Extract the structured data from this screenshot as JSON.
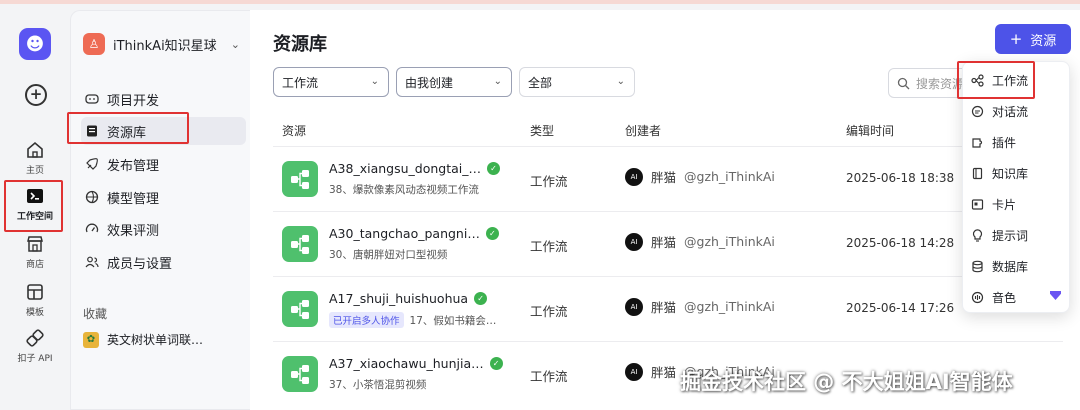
{
  "rail": {
    "items": [
      {
        "label": "主页",
        "icon": "home-icon"
      },
      {
        "label": "工作空间",
        "icon": "terminal-icon"
      },
      {
        "label": "商店",
        "icon": "store-icon"
      },
      {
        "label": "模板",
        "icon": "template-icon"
      },
      {
        "label": "扣子 API",
        "icon": "api-icon"
      }
    ]
  },
  "space": {
    "name": "iThinkAi知识星球"
  },
  "nav": {
    "items": [
      {
        "label": "项目开发",
        "icon": "gamepad-icon"
      },
      {
        "label": "资源库",
        "icon": "library-icon"
      },
      {
        "label": "发布管理",
        "icon": "rocket-icon"
      },
      {
        "label": "模型管理",
        "icon": "model-icon"
      },
      {
        "label": "效果评测",
        "icon": "gauge-icon"
      },
      {
        "label": "成员与设置",
        "icon": "members-icon"
      }
    ],
    "favorites_title": "收藏",
    "favorites": [
      {
        "label": "英文树状单词联…"
      }
    ]
  },
  "main": {
    "title": "资源库",
    "add_button": "资源",
    "filters": {
      "type": "工作流",
      "creator": "由我创建",
      "status": "全部"
    },
    "search_placeholder": "搜索资源",
    "columns": {
      "resource": "资源",
      "type": "类型",
      "creator": "创建者",
      "edit_time": "编辑时间"
    },
    "rows": [
      {
        "name": "A38_xiangsu_dongtai_…",
        "desc": "38、爆款像素风动态视频工作流",
        "collab": "",
        "type": "工作流",
        "creator": "胖猫",
        "handle": "@gzh_iThinkAi",
        "time": "2025-06-18 18:38"
      },
      {
        "name": "A30_tangchao_pangni…",
        "desc": "30、唐朝胖妞对口型视频",
        "collab": "",
        "type": "工作流",
        "creator": "胖猫",
        "handle": "@gzh_iThinkAi",
        "time": "2025-06-18 14:28"
      },
      {
        "name": "A17_shuji_huishuohua",
        "desc": "17、假如书籍会…",
        "collab": "已开启多人协作",
        "type": "工作流",
        "creator": "胖猫",
        "handle": "@gzh_iThinkAi",
        "time": "2025-06-14 17:26"
      },
      {
        "name": "A37_xiaochawu_hunjia…",
        "desc": "37、小茶悟混剪视频",
        "collab": "",
        "type": "工作流",
        "creator": "胖猫",
        "handle": "@gzh_iThinkAi",
        "time": ""
      }
    ]
  },
  "dropdown": {
    "items": [
      {
        "label": "工作流",
        "icon": "workflow-icon"
      },
      {
        "label": "对话流",
        "icon": "chatflow-icon"
      },
      {
        "label": "插件",
        "icon": "plugin-icon"
      },
      {
        "label": "知识库",
        "icon": "knowledge-icon"
      },
      {
        "label": "卡片",
        "icon": "card-icon"
      },
      {
        "label": "提示词",
        "icon": "bulb-icon"
      },
      {
        "label": "数据库",
        "icon": "database-icon"
      },
      {
        "label": "音色",
        "icon": "voice-icon"
      }
    ]
  },
  "watermark": "掘金技术社区 @ 不大姐姐AI智能体"
}
